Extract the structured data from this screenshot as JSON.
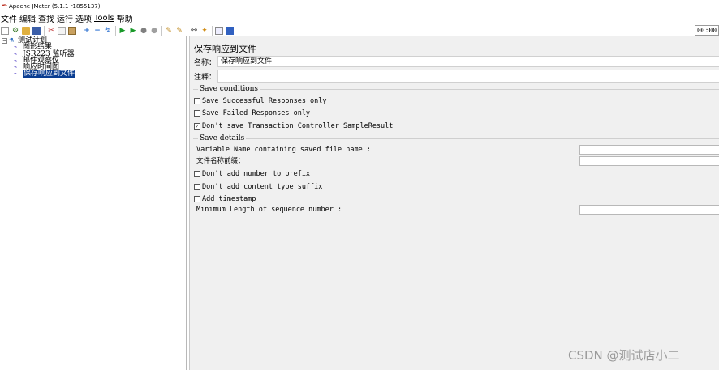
{
  "window": {
    "title": "Apache JMeter (5.1.1 r1855137)"
  },
  "menu": [
    "文件",
    "编辑",
    "查找",
    "运行",
    "选项",
    "Tools",
    "帮助"
  ],
  "toolbar": {
    "icons": [
      "new-icon",
      "templates-icon",
      "open-icon",
      "save-icon",
      "cut-icon",
      "copy-icon",
      "paste-icon",
      "expand-icon",
      "collapse-icon",
      "toggle-icon",
      "start-icon",
      "start-no-pause-icon",
      "stop-icon",
      "shutdown-icon",
      "clear-icon",
      "clear-all-icon",
      "search-icon",
      "reset-search-icon",
      "function-helper-icon",
      "help-icon"
    ],
    "timer": "00:00"
  },
  "tree": {
    "root": "测试计划",
    "items": [
      {
        "label": "图形结果",
        "selected": false
      },
      {
        "label": "JSR223 监听器",
        "selected": false
      },
      {
        "label": "邮件观察仪",
        "selected": false
      },
      {
        "label": "响应时间图",
        "selected": false
      },
      {
        "label": "保存响应到文件",
        "selected": true
      }
    ]
  },
  "panel": {
    "title": "保存响应到文件",
    "name_label": "名称：",
    "name_value": "保存响应到文件",
    "comment_label": "注释：",
    "comment_value": "",
    "save_conditions": {
      "title": "Save conditions",
      "options": [
        {
          "label": "Save Successful Responses only",
          "checked": false
        },
        {
          "label": "Save Failed Responses only",
          "checked": false
        },
        {
          "label": "Don't save Transaction Controller SampleResult",
          "checked": true
        }
      ]
    },
    "save_details": {
      "title": "Save details",
      "variable_name_label": "Variable Name containing saved file name :",
      "prefix_label": "文件名称前缀：",
      "options": [
        {
          "label": "Don't add number to prefix",
          "checked": false
        },
        {
          "label": "Don't add content type suffix",
          "checked": false
        },
        {
          "label": "Add timestamp",
          "checked": false
        }
      ],
      "min_length_label": "Minimum Length of sequence number :"
    }
  },
  "watermark": "CSDN @测试店小二",
  "colors": {
    "selection": "#0a3d91",
    "panel_bg": "#f0f0f0"
  }
}
